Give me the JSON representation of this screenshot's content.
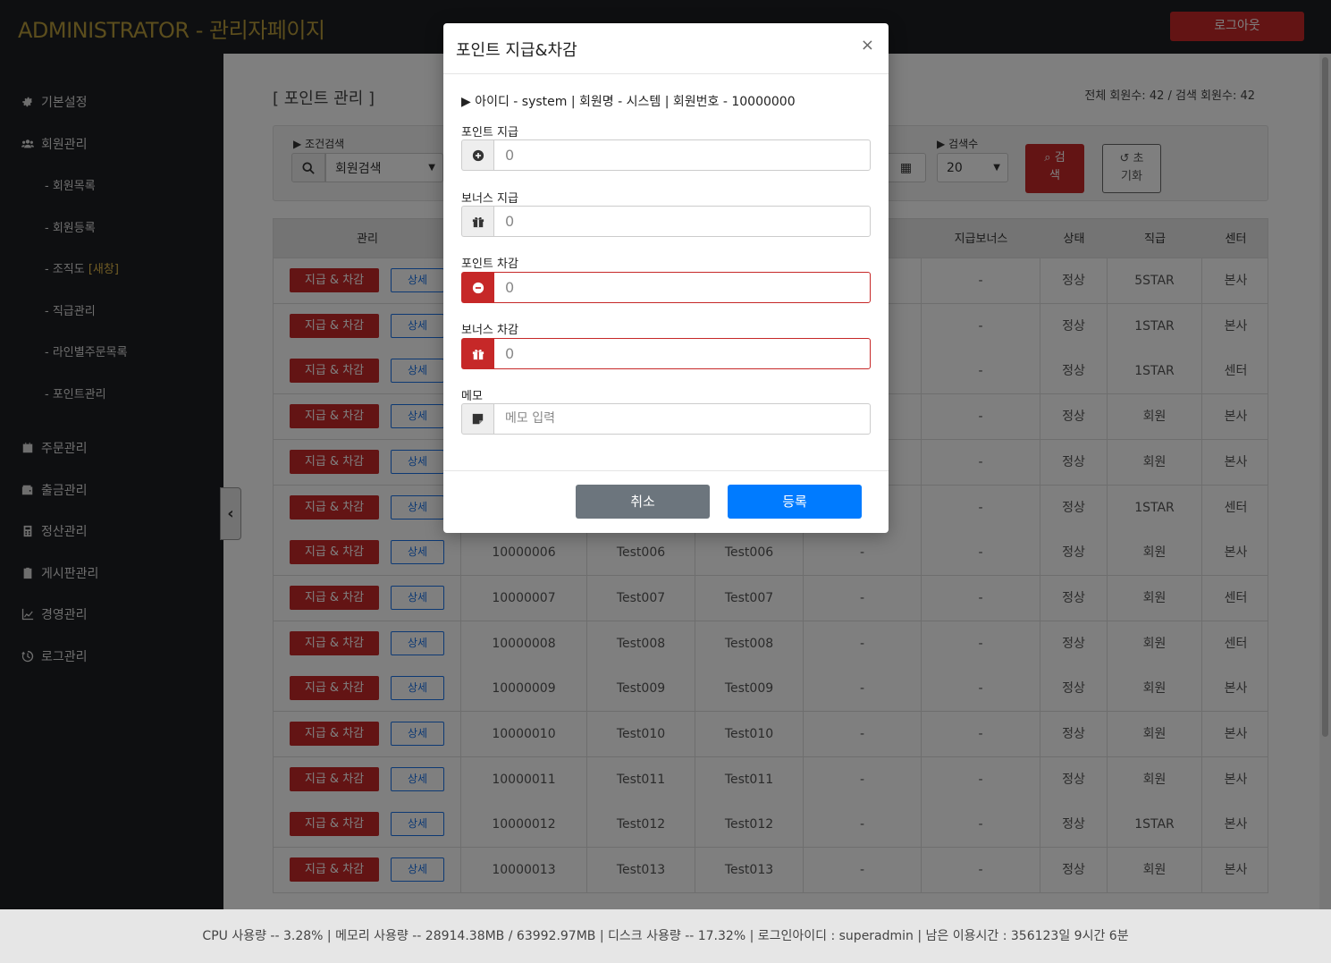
{
  "header": {
    "brand": "ADMINISTRATOR - 관리자페이지",
    "logout_label": "로그아웃"
  },
  "sidebar": {
    "items": [
      {
        "label": "기본설정",
        "icon": "gear-icon"
      },
      {
        "label": "회원관리",
        "icon": "users-icon"
      },
      {
        "label": "주문관리",
        "icon": "calendar-icon"
      },
      {
        "label": "출금관리",
        "icon": "wallet-icon"
      },
      {
        "label": "정산관리",
        "icon": "calculator-icon"
      },
      {
        "label": "게시판관리",
        "icon": "clipboard-icon"
      },
      {
        "label": "경영관리",
        "icon": "chart-line-icon"
      },
      {
        "label": "로그관리",
        "icon": "history-icon"
      }
    ],
    "sub_items": [
      {
        "label": "- 회원목록"
      },
      {
        "label": "- 회원등록"
      },
      {
        "label": "- 조직도 ",
        "badge": "[새창]"
      },
      {
        "label": "- 직급관리"
      },
      {
        "label": "- 라인별주문목록"
      },
      {
        "label": "- 포인트관리"
      }
    ]
  },
  "main": {
    "title": "[ 포인트 관리 ]",
    "counts": "전체 회원수: 42 / 검색 회원수: 42",
    "search": {
      "condition_label": "▶ 조건검색",
      "condition_value": "회원검색",
      "count_label": "▶ 검색수",
      "count_value": "20",
      "search_label_1": "검",
      "search_label_2": "색",
      "reset_label_1": "초",
      "reset_label_2": "기화"
    },
    "table": {
      "headers": [
        "관리",
        "지급보너스",
        "상태",
        "직급",
        "센터"
      ],
      "pay_label": "지급 & 차감",
      "detail_label": "상세",
      "rows": [
        {
          "no": "",
          "id": "",
          "name": "",
          "p": "",
          "bonus": "-",
          "status": "정상",
          "rank": "5STAR",
          "center": "본사"
        },
        {
          "no": "",
          "id": "",
          "name": "",
          "p": "",
          "bonus": "-",
          "status": "정상",
          "rank": "1STAR",
          "center": "본사"
        },
        {
          "no": "",
          "id": "",
          "name": "",
          "p": "",
          "bonus": "-",
          "status": "정상",
          "rank": "1STAR",
          "center": "센터"
        },
        {
          "no": "",
          "id": "",
          "name": "",
          "p": "",
          "bonus": "-",
          "status": "정상",
          "rank": "회원",
          "center": "본사"
        },
        {
          "no": "",
          "id": "",
          "name": "",
          "p": "",
          "bonus": "-",
          "status": "정상",
          "rank": "회원",
          "center": "본사"
        },
        {
          "no": "",
          "id": "",
          "name": "",
          "p": "",
          "bonus": "-",
          "status": "정상",
          "rank": "1STAR",
          "center": "센터"
        },
        {
          "no": "10000006",
          "id": "Test006",
          "name": "Test006",
          "p": "-",
          "bonus": "-",
          "status": "정상",
          "rank": "회원",
          "center": "본사"
        },
        {
          "no": "10000007",
          "id": "Test007",
          "name": "Test007",
          "p": "-",
          "bonus": "-",
          "status": "정상",
          "rank": "회원",
          "center": "센터"
        },
        {
          "no": "10000008",
          "id": "Test008",
          "name": "Test008",
          "p": "-",
          "bonus": "-",
          "status": "정상",
          "rank": "회원",
          "center": "센터"
        },
        {
          "no": "10000009",
          "id": "Test009",
          "name": "Test009",
          "p": "-",
          "bonus": "-",
          "status": "정상",
          "rank": "회원",
          "center": "본사"
        },
        {
          "no": "10000010",
          "id": "Test010",
          "name": "Test010",
          "p": "-",
          "bonus": "-",
          "status": "정상",
          "rank": "회원",
          "center": "본사"
        },
        {
          "no": "10000011",
          "id": "Test011",
          "name": "Test011",
          "p": "-",
          "bonus": "-",
          "status": "정상",
          "rank": "회원",
          "center": "본사"
        },
        {
          "no": "10000012",
          "id": "Test012",
          "name": "Test012",
          "p": "-",
          "bonus": "-",
          "status": "정상",
          "rank": "1STAR",
          "center": "본사"
        },
        {
          "no": "10000013",
          "id": "Test013",
          "name": "Test013",
          "p": "-",
          "bonus": "-",
          "status": "정상",
          "rank": "회원",
          "center": "본사"
        }
      ]
    }
  },
  "modal": {
    "title": "포인트 지급&차감",
    "close": "×",
    "member_info": "▶ 아이디 - system | 회원명 - 시스템 | 회원번호 - 10000000",
    "fields": [
      {
        "label": "포인트 지급",
        "value": "0",
        "icon": "plus-circle-icon"
      },
      {
        "label": "보너스 지급",
        "value": "0",
        "icon": "gift-icon"
      },
      {
        "label": "포인트 차감",
        "value": "0",
        "icon": "minus-circle-icon"
      },
      {
        "label": "보너스 차감",
        "value": "0",
        "icon": "gift-icon"
      }
    ],
    "memo_label": "메모",
    "memo_placeholder": "메모 입력",
    "cancel_label": "취소",
    "submit_label": "등록"
  },
  "footer": {
    "status": "CPU 사용량 -- 3.28% | 메모리 사용량 -- 28914.38MB / 63992.97MB | 디스크 사용량 -- 17.32%  |   로그인아이디 : superadmin  |   남은 이용시간 : 356123일 9시간 6분"
  },
  "colors": {
    "brand": "#b69a3a",
    "danger": "#c62828",
    "primary": "#007bff",
    "secondary": "#6c757d"
  }
}
